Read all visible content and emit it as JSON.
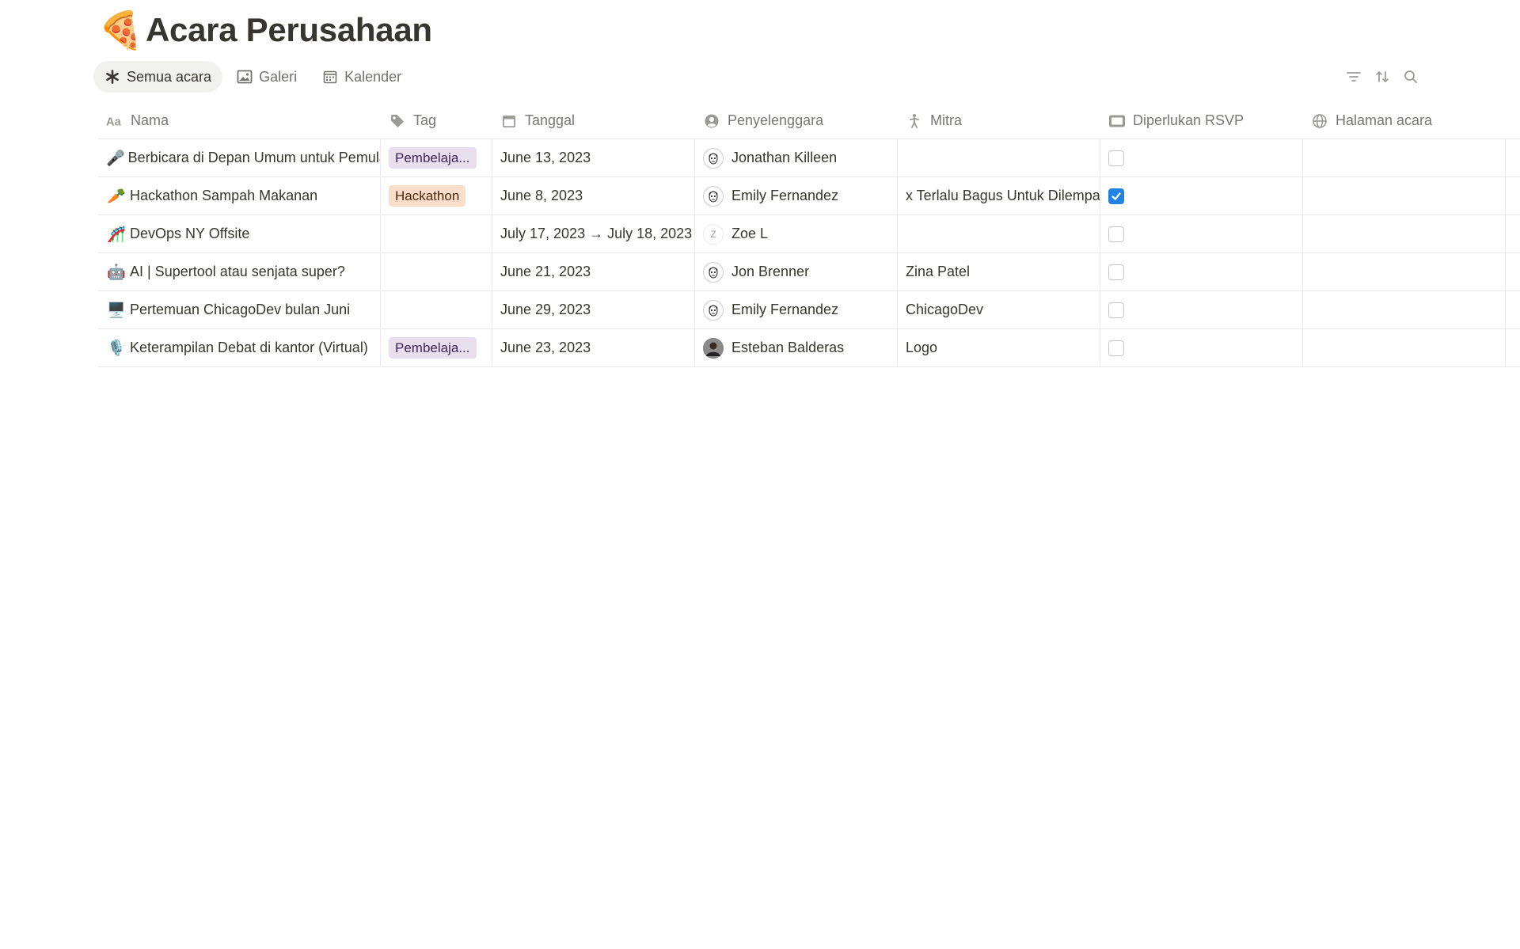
{
  "page": {
    "icon": "🍕",
    "title": "Acara Perusahaan"
  },
  "tabs": [
    {
      "label": "Semua acara",
      "icon": "asterisk-icon",
      "active": true
    },
    {
      "label": "Galeri",
      "icon": "image-icon",
      "active": false
    },
    {
      "label": "Kalender",
      "icon": "calendar-icon",
      "active": false
    }
  ],
  "toolbar": [
    "filter-icon",
    "sort-icon",
    "search-icon"
  ],
  "columns": [
    {
      "label": "Nama",
      "icon": "text-property-icon"
    },
    {
      "label": "Tag",
      "icon": "tag-icon"
    },
    {
      "label": "Tanggal",
      "icon": "calendar-icon"
    },
    {
      "label": "Penyelenggara",
      "icon": "person-icon"
    },
    {
      "label": "Mitra",
      "icon": "walking-person-icon"
    },
    {
      "label": "Diperlukan RSVP",
      "icon": "checkbox-icon"
    },
    {
      "label": "Halaman acara",
      "icon": "globe-icon"
    }
  ],
  "rows": [
    {
      "emoji": "🎤",
      "name": "Berbicara di Depan Umum untuk Pemula",
      "tag": "Pembelaja...",
      "tag_color": "purple",
      "date": "June 13, 2023",
      "organizer": "Jonathan Killeen",
      "organizer_avatar": "sketch",
      "partner": "",
      "rsvp": false
    },
    {
      "emoji": "🥕",
      "name": "Hackathon Sampah Makanan",
      "tag": "Hackathon",
      "tag_color": "orange",
      "date": "June 8, 2023",
      "organizer": "Emily Fernandez",
      "organizer_avatar": "sketch",
      "partner": "x Terlalu Bagus Untuk Dilempar",
      "rsvp": true
    },
    {
      "emoji": "🎢",
      "name": "DevOps NY Offsite",
      "tag": "",
      "tag_color": "",
      "date": "July 17, 2023 → July 18, 2023",
      "organizer": "Zoe L",
      "organizer_avatar": "letter",
      "organizer_initial": "Z",
      "partner": "",
      "rsvp": false
    },
    {
      "emoji": "🤖",
      "name": "AI | Supertool atau senjata super?",
      "tag": "",
      "tag_color": "",
      "date": "June 21, 2023",
      "organizer": "Jon Brenner",
      "organizer_avatar": "sketch",
      "partner": "Zina Patel",
      "rsvp": false
    },
    {
      "emoji": "🖥️",
      "name": "Pertemuan ChicagoDev bulan Juni",
      "tag": "",
      "tag_color": "",
      "date": "June 29, 2023",
      "organizer": "Emily Fernandez",
      "organizer_avatar": "sketch",
      "partner": "ChicagoDev",
      "rsvp": false
    },
    {
      "emoji": "🎙️",
      "name": "Keterampilan Debat di kantor (Virtual)",
      "tag": "Pembelaja...",
      "tag_color": "purple",
      "date": "June 23, 2023",
      "organizer": "Esteban Balderas",
      "organizer_avatar": "photo",
      "partner": "Logo",
      "rsvp": false
    }
  ]
}
